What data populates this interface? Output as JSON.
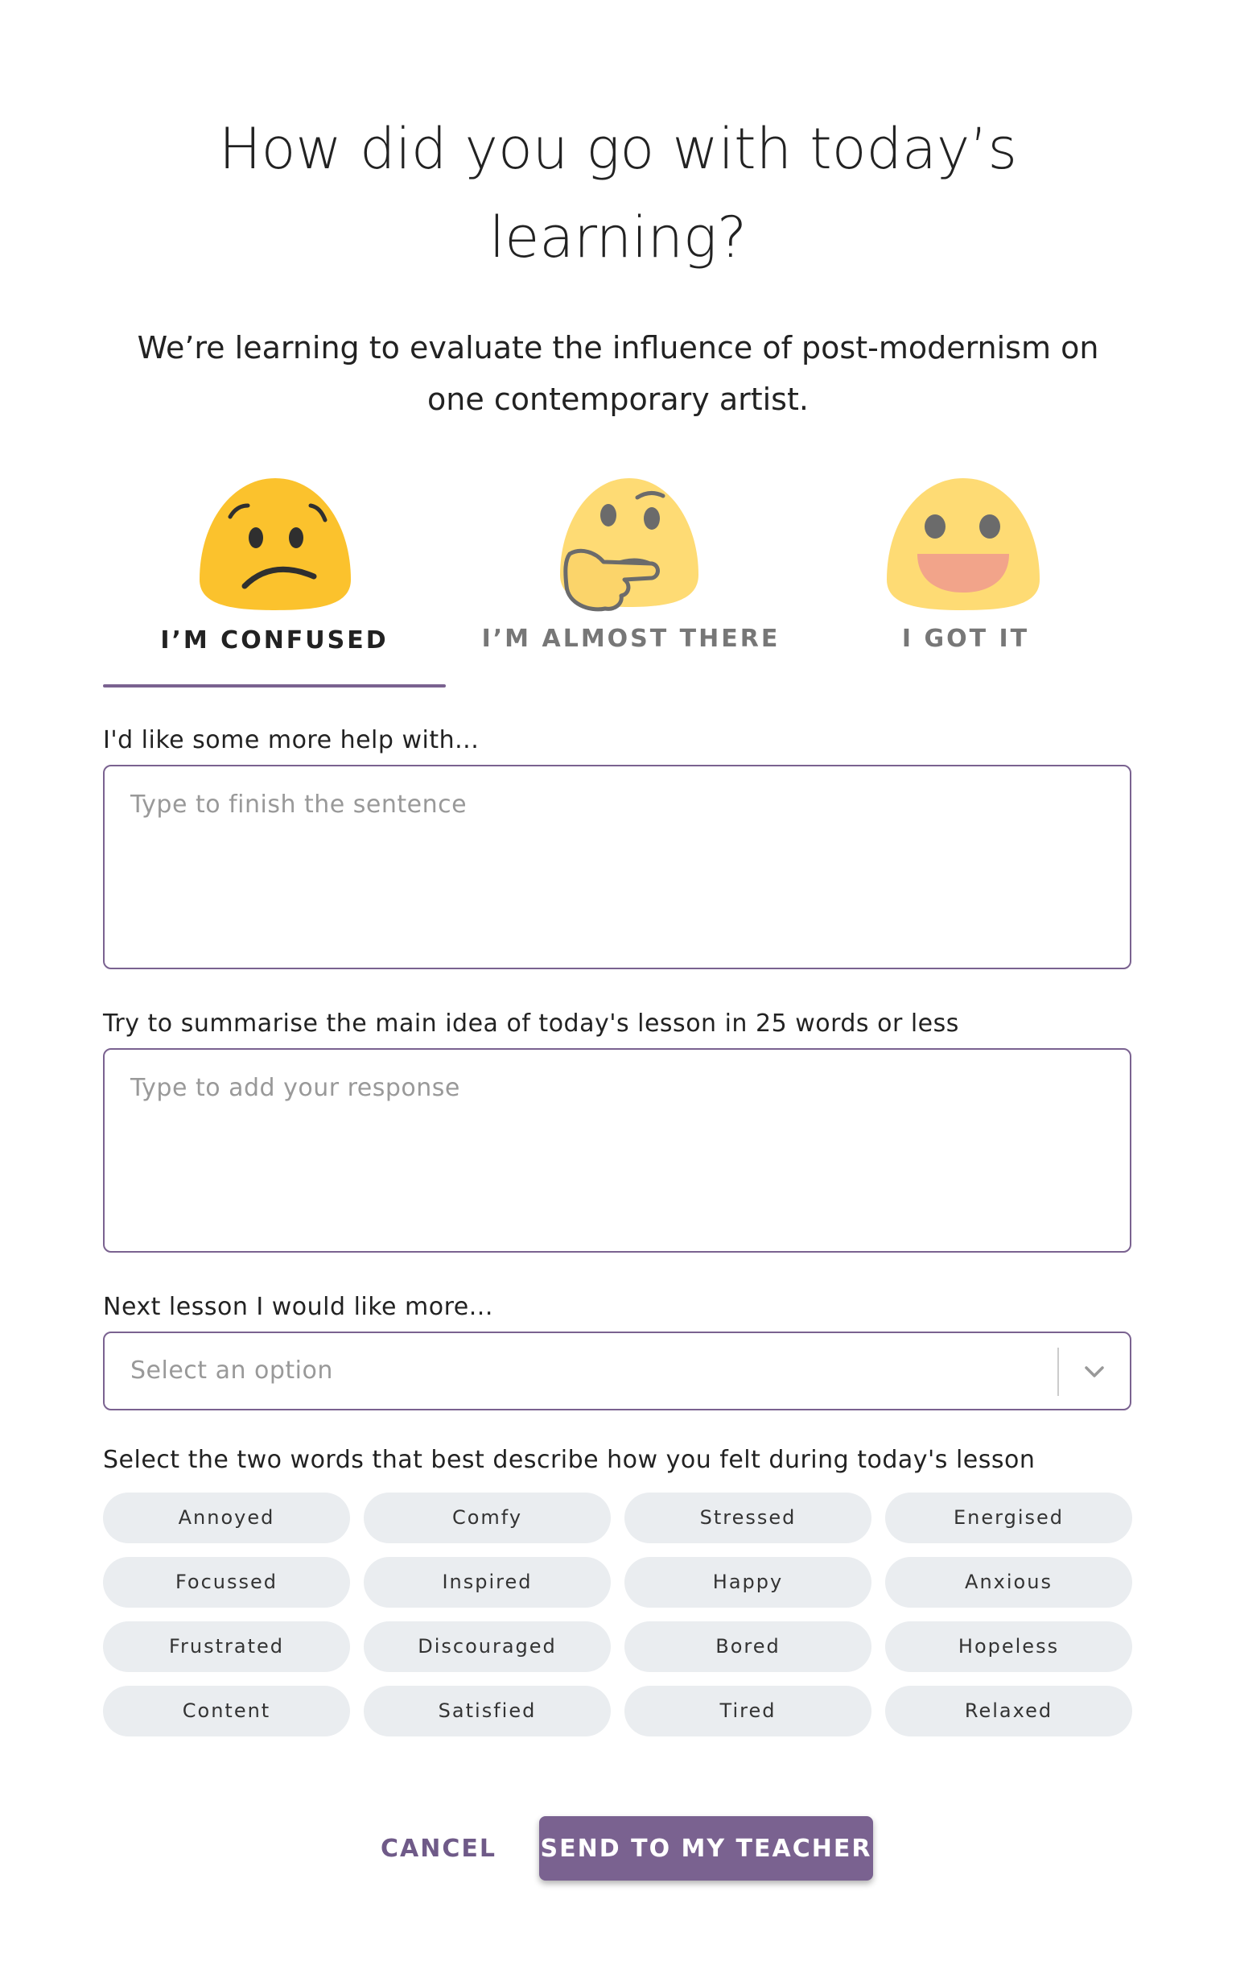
{
  "header": {
    "title_line1": "How did you go with today’s",
    "title_line2": "learning?",
    "objective_line1": "We’re learning to evaluate the influence of post-modernism on",
    "objective_line2": "one contemporary artist."
  },
  "tabs": [
    {
      "label": "I’M CONFUSED",
      "icon": "confused-face-icon",
      "selected": true
    },
    {
      "label": "I’M ALMOST THERE",
      "icon": "thinking-face-icon",
      "selected": false
    },
    {
      "label": "I GOT IT",
      "icon": "smiling-face-icon",
      "selected": false
    }
  ],
  "help_field": {
    "label": "I'd like some more help with...",
    "placeholder": "Type to finish the sentence",
    "value": ""
  },
  "summary_field": {
    "label": "Try to summarise the main idea of today's lesson in 25 words or less",
    "placeholder": "Type to add your response",
    "value": ""
  },
  "next_lesson": {
    "label": "Next lesson I would like more...",
    "placeholder": "Select an option",
    "icon": "chevron-down-icon"
  },
  "feelings": {
    "label": "Select the two words that best describe how you felt during today's lesson",
    "words": [
      "Annoyed",
      "Comfy",
      "Stressed",
      "Energised",
      "Focussed",
      "Inspired",
      "Happy",
      "Anxious",
      "Frustrated",
      "Discouraged",
      "Bored",
      "Hopeless",
      "Content",
      "Satisfied",
      "Tired",
      "Relaxed"
    ]
  },
  "actions": {
    "cancel": "CANCEL",
    "send": "SEND TO MY TEACHER"
  },
  "colors": {
    "accent": "#7a6290",
    "chip_bg": "#eaedf0",
    "emoji_yellow": "#fbc22d",
    "emoji_pale_yellow": "#fedb74"
  }
}
